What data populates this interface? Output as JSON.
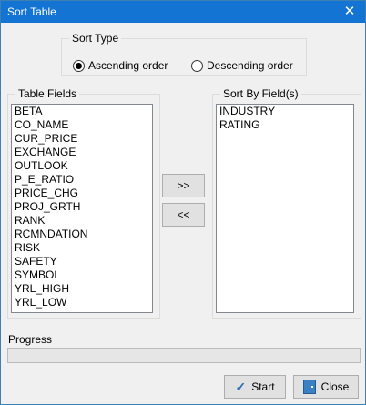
{
  "window": {
    "title": "Sort Table",
    "close_glyph": "✕"
  },
  "sort_type": {
    "legend": "Sort Type",
    "options": [
      {
        "label": "Ascending order",
        "selected": true
      },
      {
        "label": "Descending order",
        "selected": false
      }
    ]
  },
  "table_fields": {
    "legend": "Table Fields",
    "items": [
      "BETA",
      "CO_NAME",
      "CUR_PRICE",
      "EXCHANGE",
      "OUTLOOK",
      "P_E_RATIO",
      "PRICE_CHG",
      "PROJ_GRTH",
      "RANK",
      "RCMNDATION",
      "RISK",
      "SAFETY",
      "SYMBOL",
      "YRL_HIGH",
      "YRL_LOW"
    ]
  },
  "sort_by": {
    "legend": "Sort By Field(s)",
    "items": [
      "INDUSTRY",
      "RATING"
    ]
  },
  "move_buttons": {
    "add": ">>",
    "remove": "<<"
  },
  "progress": {
    "label": "Progress",
    "value": 0
  },
  "actions": {
    "start": "Start",
    "close": "Close"
  },
  "icons": {
    "start": "check-icon",
    "close": "door-icon"
  },
  "colors": {
    "titlebar": "#1474d4",
    "progress_fill": "#06b025"
  }
}
